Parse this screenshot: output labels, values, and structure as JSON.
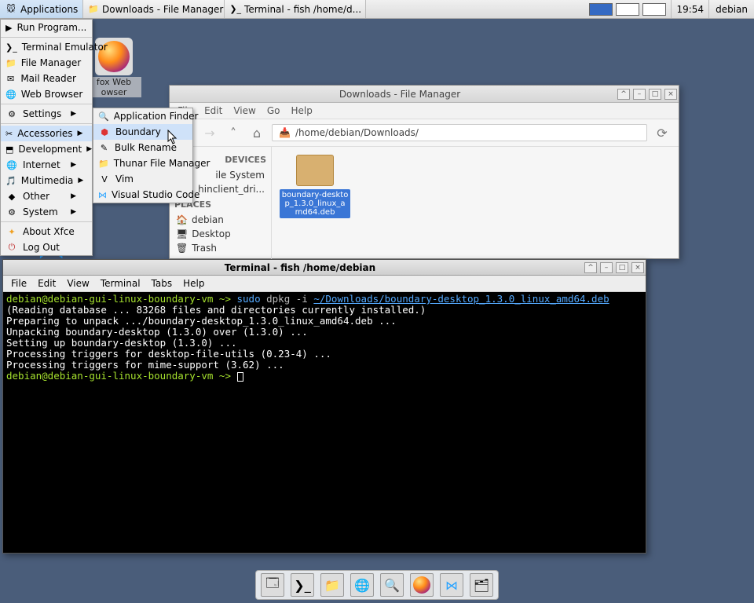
{
  "panel": {
    "apps_label": "Applications",
    "task1": "Downloads - File Manager",
    "task2": "Terminal - fish /home/d...",
    "clock": "19:54",
    "user": "debian"
  },
  "desktop": {
    "firefox_label": "fox Web owser"
  },
  "app_menu": {
    "items": [
      "Run Program...",
      "Terminal Emulator",
      "File Manager",
      "Mail Reader",
      "Web Browser"
    ],
    "settings": "Settings",
    "cats": [
      "Accessories",
      "Development",
      "Internet",
      "Multimedia",
      "Other",
      "System"
    ],
    "about": "About Xfce",
    "logout": "Log Out"
  },
  "submenu": {
    "items": [
      "Application Finder",
      "Boundary",
      "Bulk Rename",
      "Thunar File Manager",
      "Vim",
      "Visual Studio Code"
    ]
  },
  "fm": {
    "title": "Downloads - File Manager",
    "menus": [
      "File",
      "Edit",
      "View",
      "Go",
      "Help"
    ],
    "path": "/home/debian/Downloads/",
    "devices": "DEVICES",
    "dev_items": [
      "ile System",
      "hinclient_dri..."
    ],
    "places": "PLACES",
    "place_items": [
      "debian",
      "Desktop",
      "Trash"
    ],
    "file_name": "boundary-desktop_1.3.0_linux_amd64.deb"
  },
  "terminal": {
    "title": "Terminal - fish /home/debian",
    "menus": [
      "File",
      "Edit",
      "View",
      "Terminal",
      "Tabs",
      "Help"
    ],
    "prompt1": "debian@debian-gui-linux-boundary-vm ~> ",
    "sudo": "sudo",
    "dpkg": " dpkg -i ",
    "pkg_path": "~/Downloads/boundary-desktop_1.3.0_linux_amd64.deb",
    "out1": "(Reading database ... 83268 files and directories currently installed.)",
    "out2": "Preparing to unpack .../boundary-desktop_1.3.0_linux_amd64.deb ...",
    "out3": "Unpacking boundary-desktop (1.3.0) over (1.3.0) ...",
    "out4": "Setting up boundary-desktop (1.3.0) ...",
    "out5": "Processing triggers for desktop-file-utils (0.23-4) ...",
    "out6": "Processing triggers for mime-support (3.62) ...",
    "prompt2": "debian@debian-gui-linux-boundary-vm ~> "
  }
}
